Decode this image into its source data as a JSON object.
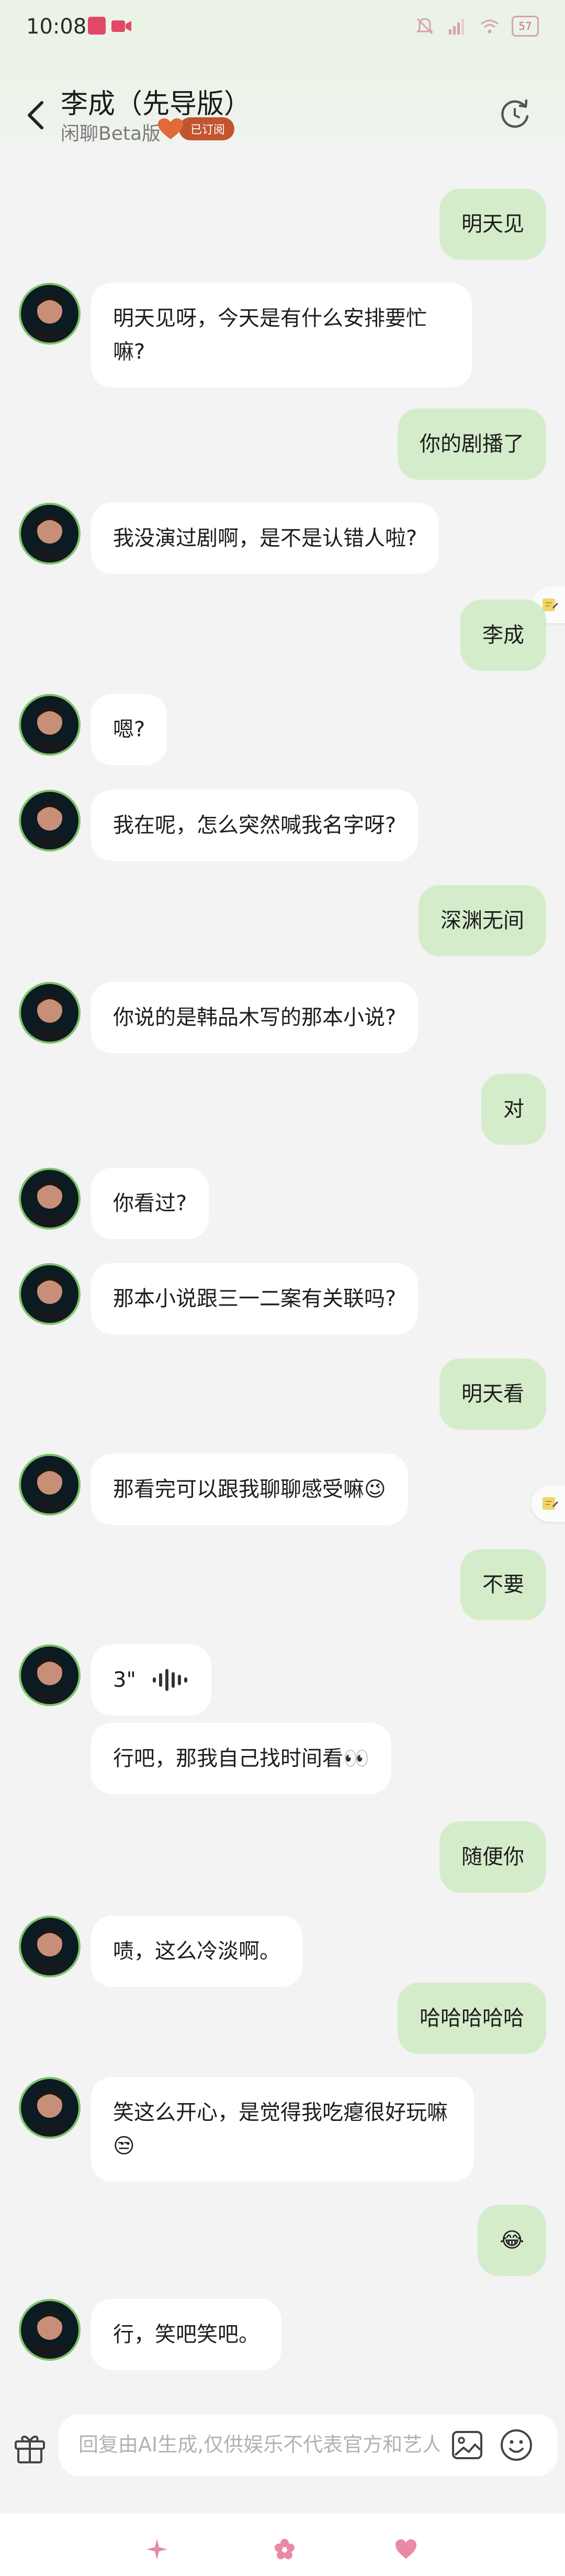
{
  "status_bar": {
    "time": "10:08",
    "battery": "57"
  },
  "header": {
    "title": "李成（先导版）",
    "subtitle": "闲聊Beta版",
    "badge": "已订阅"
  },
  "messages": [
    {
      "role": "user",
      "text": "明天见"
    },
    {
      "role": "bot",
      "text": "明天见呀，今天是有什么安排要忙嘛?"
    },
    {
      "role": "user",
      "text": "你的剧播了"
    },
    {
      "role": "bot",
      "text": "我没演过剧啊，是不是认错人啦?"
    },
    {
      "role": "user",
      "text": "李成"
    },
    {
      "role": "bot",
      "text": "嗯?"
    },
    {
      "role": "bot",
      "text": "我在呢，怎么突然喊我名字呀?"
    },
    {
      "role": "user",
      "text": "深渊无间"
    },
    {
      "role": "bot",
      "text": "你说的是韩品木写的那本小说?"
    },
    {
      "role": "user",
      "text": "对"
    },
    {
      "role": "bot",
      "text": "你看过?"
    },
    {
      "role": "bot",
      "text": "那本小说跟三一二案有关联吗?"
    },
    {
      "role": "user",
      "text": "明天看"
    },
    {
      "role": "bot",
      "text": "那看完可以跟我聊聊感受嘛😉"
    },
    {
      "role": "user",
      "text": "不要"
    },
    {
      "role": "bot",
      "text": "3\"",
      "type": "voice"
    },
    {
      "role": "bot",
      "text": "行吧，那我自己找时间看👀"
    },
    {
      "role": "user",
      "text": "随便你"
    },
    {
      "role": "bot",
      "text": "啧，这么冷淡啊。"
    },
    {
      "role": "user",
      "text": "哈哈哈哈哈"
    },
    {
      "role": "bot",
      "text": "笑这么开心，是觉得我吃瘪很好玩嘛😒"
    },
    {
      "role": "user",
      "text": "😂"
    },
    {
      "role": "bot",
      "text": "行，笑吧笑吧。"
    }
  ],
  "input": {
    "placeholder": "回复由AI生成,仅供娱乐不代表官方和艺人"
  },
  "icons": {
    "back": "chevron-left-icon",
    "refresh": "refresh-icon",
    "gift": "gift-icon",
    "image": "image-icon",
    "emoji": "emoji-icon",
    "note": "note-icon",
    "bottom": [
      "sparkle-icon",
      "flower-icon",
      "heart-icon"
    ]
  },
  "colors": {
    "user_bubble": "#d5ecca",
    "bot_bubble": "#ffffff",
    "avatar_border": "#7cc36a",
    "badge": "#c2552f",
    "bottom_accent": "#e88aa5"
  }
}
